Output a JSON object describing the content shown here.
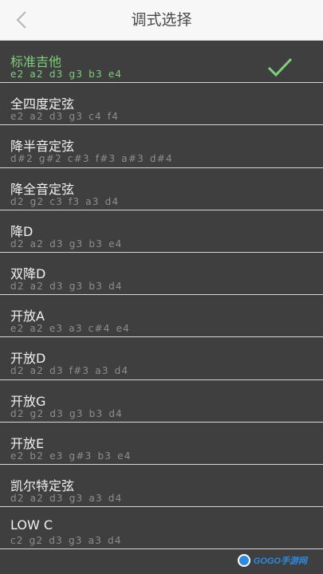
{
  "header": {
    "title": "调式选择",
    "back_icon": "chevron-left-icon"
  },
  "tunings": [
    {
      "name": "标准吉他",
      "notes": "e2 a2 d3 g3 b3 e4",
      "selected": true
    },
    {
      "name": "全四度定弦",
      "notes": "e2 a2 d3 g3 c4 f4"
    },
    {
      "name": "降半音定弦",
      "notes": "d#2 g#2 c#3 f#3 a#3 d#4"
    },
    {
      "name": "降全音定弦",
      "notes": "d2 g2 c3 f3 a3 d4"
    },
    {
      "name": "降D",
      "notes": "d2 a2 d3 g3 b3 e4"
    },
    {
      "name": "双降D",
      "notes": "d2 a2 d3 g3 b3 d4"
    },
    {
      "name": "开放A",
      "notes": "e2 a2 e3 a3 c#4 e4"
    },
    {
      "name": "开放D",
      "notes": "d2 a2 d3 f#3 a3 d4"
    },
    {
      "name": "开放G",
      "notes": "d2 g2 d3 g3 b3 d4"
    },
    {
      "name": "开放E",
      "notes": "e2 b2 e3 g#3 b3 e4"
    },
    {
      "name": "凯尔特定弦",
      "notes": "d2 a2 d3 g3 a3 d4"
    },
    {
      "name": "LOW C",
      "notes": "c2 g2 d3 g3 a3 d4"
    }
  ],
  "watermark": {
    "text": "GOGO手游网"
  },
  "colors": {
    "accent": "#7ed07a",
    "background": "#3f3f3f",
    "header": "#f7f7f7"
  }
}
